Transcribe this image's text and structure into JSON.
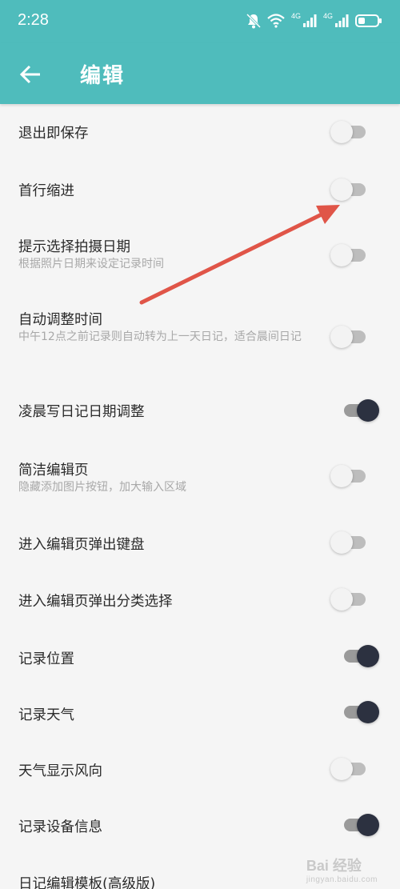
{
  "status_bar": {
    "time": "2:28",
    "network_label_1": "4G",
    "network_label_2": "4G",
    "icons": [
      "mute-bell-icon",
      "wifi-icon",
      "signal-icon",
      "signal-icon",
      "battery-icon"
    ]
  },
  "app_bar": {
    "back_icon": "arrow-left-icon",
    "title": "编辑"
  },
  "settings": [
    {
      "title": "退出即保存",
      "subtitle": "",
      "enabled": false
    },
    {
      "title": "首行缩进",
      "subtitle": "",
      "enabled": false
    },
    {
      "title": "提示选择拍摄日期",
      "subtitle": "根据照片日期来设定记录时间",
      "enabled": false
    },
    {
      "title": "自动调整时间",
      "subtitle": "中午12点之前记录则自动转为上一天日记，适合晨间日记",
      "enabled": false
    },
    {
      "title": "凌晨写日记日期调整",
      "subtitle": "",
      "enabled": true
    },
    {
      "title": "简洁编辑页",
      "subtitle": "隐藏添加图片按钮，加大输入区域",
      "enabled": false
    },
    {
      "title": "进入编辑页弹出键盘",
      "subtitle": "",
      "enabled": false
    },
    {
      "title": "进入编辑页弹出分类选择",
      "subtitle": "",
      "enabled": false
    },
    {
      "title": "记录位置",
      "subtitle": "",
      "enabled": true
    },
    {
      "title": "记录天气",
      "subtitle": "",
      "enabled": true
    },
    {
      "title": "天气显示风向",
      "subtitle": "",
      "enabled": false
    },
    {
      "title": "记录设备信息",
      "subtitle": "",
      "enabled": true
    },
    {
      "title": "日记编辑模板(高级版)",
      "subtitle": "",
      "enabled": null
    }
  ],
  "colors": {
    "app_bar": "#4fbcbc",
    "background": "#f5f5f5",
    "switch_on_thumb": "#2c3140",
    "switch_off_thumb": "#f3f3f3",
    "annotation_arrow": "#e05548"
  },
  "watermark": {
    "text": "Bai 经验",
    "sub": "jingyan.baidu.com"
  }
}
